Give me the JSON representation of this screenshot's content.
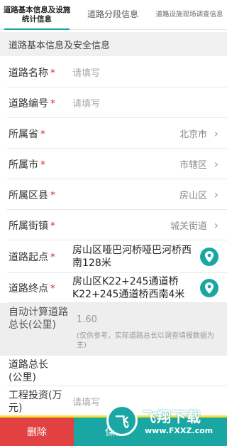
{
  "tabs": [
    {
      "label": "道路基本信息及设施统计信息",
      "active": true
    },
    {
      "label": "道路分段信息",
      "active": false
    },
    {
      "label": "道路设施现场调查信息",
      "active": false
    }
  ],
  "section": {
    "title": "道路基本信息及安全信息"
  },
  "fields": {
    "road_name": {
      "label": "道路名称",
      "required": "*",
      "placeholder": "请填写"
    },
    "road_code": {
      "label": "道路编号",
      "required": "*",
      "placeholder": "请填写"
    },
    "province": {
      "label": "所属省",
      "required": "*",
      "value": "北京市"
    },
    "city": {
      "label": "所属市",
      "required": "*",
      "value": "市辖区"
    },
    "district": {
      "label": "所属区县",
      "required": "*",
      "value": "房山区"
    },
    "street": {
      "label": "所属街镇",
      "required": "*",
      "value": "城关街道"
    },
    "start_point": {
      "label": "道路起点",
      "required": "*",
      "value": "房山区哑巴河桥哑巴河桥西南128米"
    },
    "end_point": {
      "label": "道路终点",
      "required": "*",
      "value": "房山区K22+245通道桥K22+245通道桥西南4米"
    },
    "auto_length": {
      "label": "自动计算道路总长(公里)",
      "value": "1.60",
      "note": "(仅供参考，实际道路总长以调查填报数据为主)"
    },
    "total_length": {
      "label": "道路总长(公里)"
    },
    "investment": {
      "label": "工程投资(万元)",
      "placeholder": "请填写"
    }
  },
  "actions": {
    "delete": "删除",
    "save": "保存"
  },
  "watermark": {
    "logo_text": "飞",
    "title": "飞翔下载",
    "url": "www.FXXZ.com"
  },
  "colors": {
    "accent": "#1aa7a4",
    "danger": "#e14141",
    "required": "#e02b2b"
  }
}
